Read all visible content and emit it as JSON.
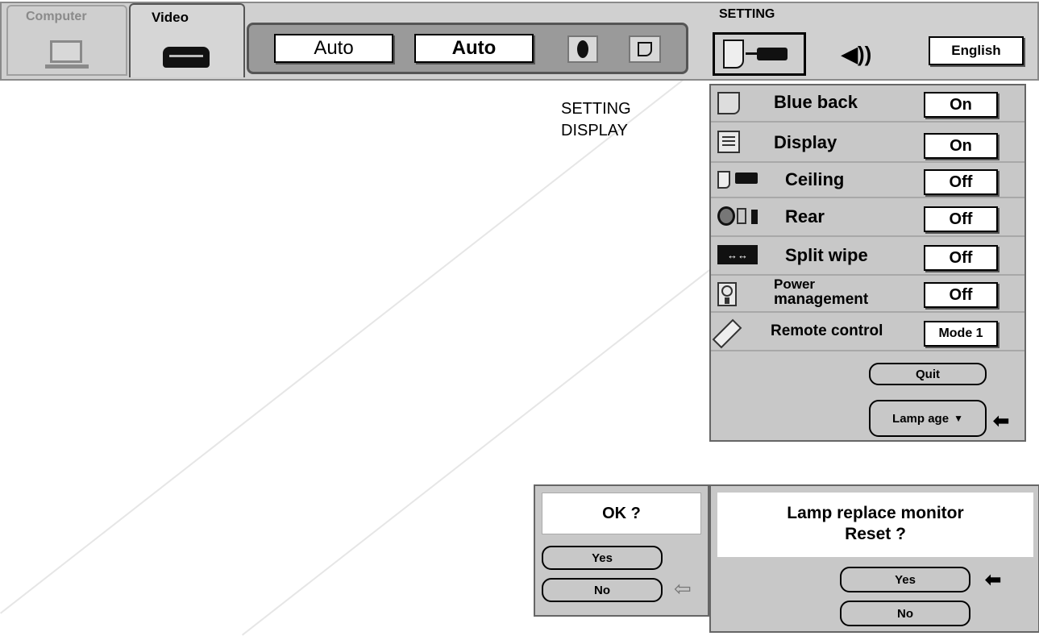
{
  "tabs": {
    "computer": "Computer",
    "video": "Video"
  },
  "toolbar": {
    "mode1": "Auto",
    "mode2": "Auto"
  },
  "setting": {
    "title": "SETTING",
    "language": "English"
  },
  "caption": {
    "line1": "SETTING",
    "line2": "DISPLAY"
  },
  "menu": {
    "items": [
      {
        "label": "Blue back",
        "value": "On"
      },
      {
        "label": "Display",
        "value": "On"
      },
      {
        "label": "Ceiling",
        "value": "Off"
      },
      {
        "label": "Rear",
        "value": "Off"
      },
      {
        "label": "Split wipe",
        "value": "Off"
      },
      {
        "label_line1": "Power",
        "label_line2": "management",
        "value": "Off"
      },
      {
        "label": "Remote control",
        "value": "Mode 1"
      }
    ],
    "quit": "Quit",
    "lamp_age": "Lamp age"
  },
  "ok_dialog": {
    "title": "OK ?",
    "yes": "Yes",
    "no": "No"
  },
  "lamp_dialog": {
    "line1": "Lamp replace monitor",
    "line2": "Reset ?",
    "yes": "Yes",
    "no": "No"
  }
}
